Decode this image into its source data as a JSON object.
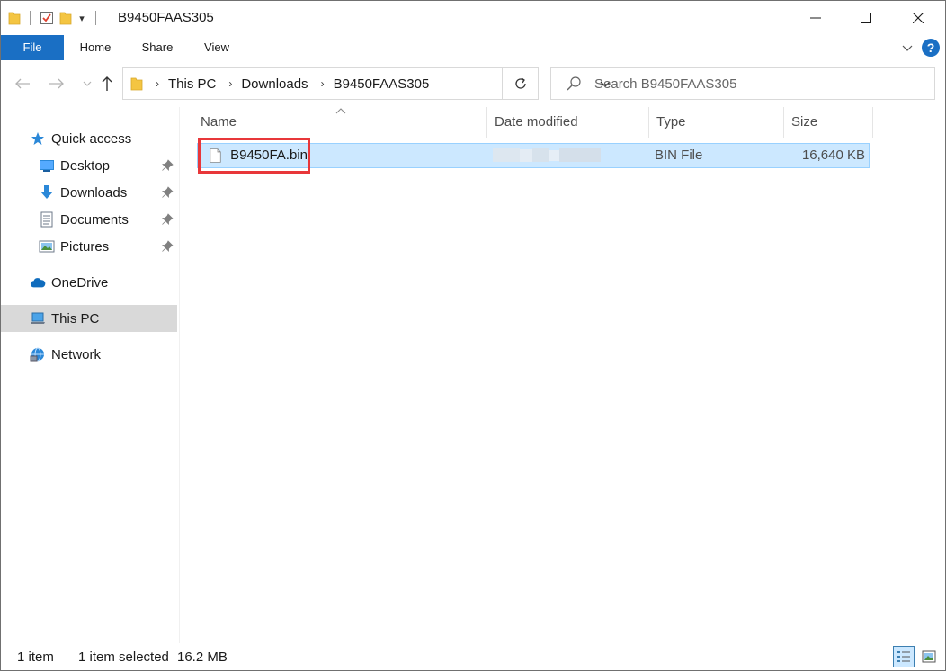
{
  "window": {
    "title": "B9450FAAS305"
  },
  "ribbon": {
    "tabs": [
      {
        "label": "File"
      },
      {
        "label": "Home"
      },
      {
        "label": "Share"
      },
      {
        "label": "View"
      }
    ],
    "help_label": "?"
  },
  "address_bar": {
    "crumbs": [
      "This PC",
      "Downloads",
      "B9450FAAS305"
    ]
  },
  "search": {
    "placeholder": "Search B9450FAAS305"
  },
  "navigation_pane": {
    "quick_access": "Quick access",
    "items": [
      {
        "label": "Desktop",
        "icon": "desktop-icon",
        "pinned": true
      },
      {
        "label": "Downloads",
        "icon": "downloads-icon",
        "pinned": true
      },
      {
        "label": "Documents",
        "icon": "documents-icon",
        "pinned": true
      },
      {
        "label": "Pictures",
        "icon": "pictures-icon",
        "pinned": true
      }
    ],
    "onedrive": "OneDrive",
    "this_pc": "This PC",
    "network": "Network"
  },
  "file_list": {
    "columns": [
      "Name",
      "Date modified",
      "Type",
      "Size"
    ],
    "sort_column": "Name",
    "rows": [
      {
        "name": "B9450FA.bin",
        "date_modified": "",
        "type": "BIN File",
        "size": "16,640 KB",
        "selected": true,
        "highlighted": true
      }
    ]
  },
  "status_bar": {
    "item_count": "1 item",
    "selection": "1 item selected",
    "selection_size": "16.2 MB"
  },
  "colors": {
    "accent": "#1a6fc4",
    "selection_bg": "#cce8ff",
    "selection_border": "#99d1ff",
    "highlight_box": "#e8373a"
  }
}
